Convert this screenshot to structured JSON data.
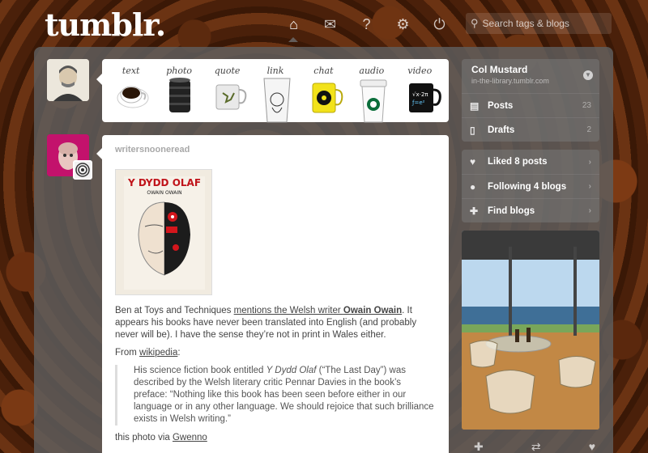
{
  "app": {
    "logo": "tumblr."
  },
  "nav": {
    "items": [
      {
        "icon": "home-icon",
        "glyph": "⌂",
        "active": true
      },
      {
        "icon": "mail-icon",
        "glyph": "✉",
        "active": false
      },
      {
        "icon": "help-icon",
        "glyph": "?",
        "active": false
      },
      {
        "icon": "gear-icon",
        "glyph": "⚙",
        "active": false
      },
      {
        "icon": "power-icon",
        "glyph": "⏻",
        "active": false
      }
    ]
  },
  "search": {
    "placeholder": "Search tags & blogs"
  },
  "post_types": [
    "text",
    "photo",
    "quote",
    "link",
    "chat",
    "audio",
    "video"
  ],
  "post": {
    "author": "writersnooneread",
    "body": {
      "p1_a": "Ben at Toys and Techniques ",
      "p1_link": "mentions the Welsh writer ",
      "p1_bold": "Owain Owain",
      "p1_b": ". It appears his books have never been translated into English (and probably never will be). I have the sense they’re not in print in Wales either.",
      "p2_a": "From ",
      "p2_link": "wikipedia",
      "p2_b": ":",
      "quote_a": "His science fiction book entitled ",
      "quote_title": "Y Dydd Olaf",
      "quote_b": " (“The Last Day”) was described by the Welsh literary critic Pennar Davies in the book’s preface: “Nothing like this book has been seen before either in our language or in any other language. We should rejoice that such brilliance exists in Welsh writing.”",
      "p3_a": "this photo via ",
      "p3_link": "Gwenno"
    },
    "photo": {
      "book_title": "Y DYDD OLAF",
      "book_author": "OWAIN OWAIN"
    }
  },
  "sidebar": {
    "blog_name": "Col Mustard",
    "blog_url": "in-the-library.tumblr.com",
    "posts_label": "Posts",
    "posts_count": "23",
    "drafts_label": "Drafts",
    "drafts_count": "2",
    "liked_label": "Liked 8 posts",
    "following_label": "Following 4 blogs",
    "find_label": "Find blogs"
  }
}
